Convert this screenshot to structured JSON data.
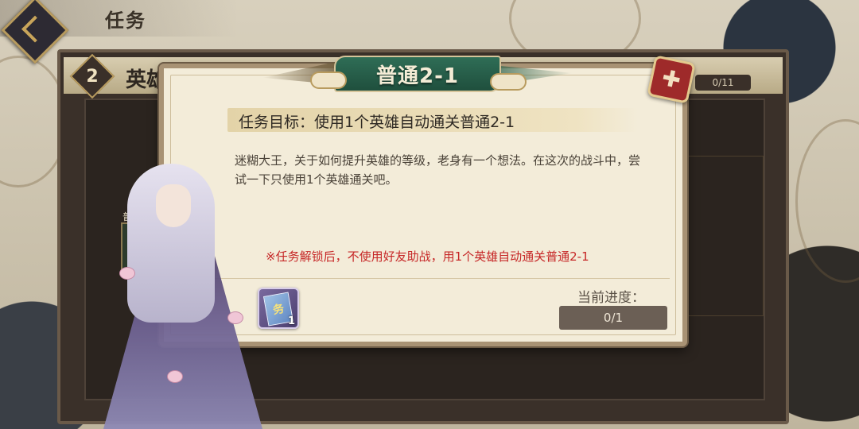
{
  "header": {
    "title": "任务"
  },
  "chapter": {
    "number": "2",
    "name": "英雄",
    "progress": "0/11",
    "stage_label": "普通"
  },
  "dialog": {
    "title": "普通2-1",
    "close_symbol": "✚",
    "goal": "任务目标：使用1个英雄自动通关普通2-1",
    "description": "迷糊大王，关于如何提升英雄的等级，老身有一个想法。在这次的战斗中，尝试一下只使用1个英雄通关吧。",
    "warning": "※任务解锁后，不使用好友助战，用1个英雄自动通关普通2-1",
    "reward": {
      "icon": "exp-card-icon",
      "glyph": "务",
      "count": "1"
    },
    "progress_label": "当前进度：",
    "progress_value": "0/1"
  },
  "colors": {
    "banner_green": "#2f6d56",
    "close_red": "#9e2a2a",
    "warning_red": "#c62626",
    "dialog_bg": "#f3ecd9"
  }
}
